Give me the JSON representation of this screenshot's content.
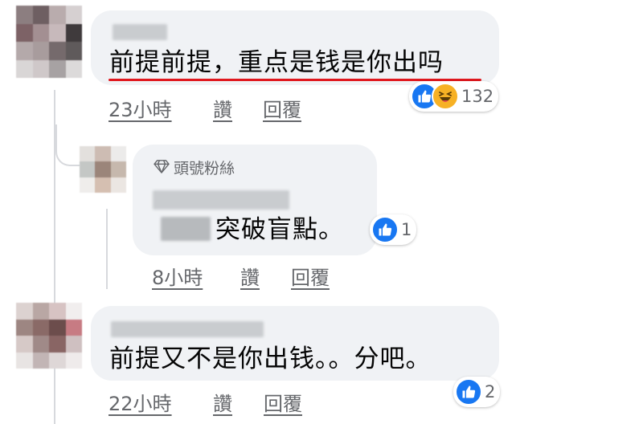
{
  "comments": [
    {
      "text": "前提前提，重点是钱是你出吗",
      "actions": {
        "time": "23小時",
        "like": "讚",
        "reply": "回覆"
      },
      "reactions": {
        "icons": [
          "like-icon",
          "haha-icon"
        ],
        "count": "132"
      }
    },
    {
      "badge": "頭號粉絲",
      "text": "突破盲點。",
      "actions": {
        "time": "8小時",
        "like": "讚",
        "reply": "回覆"
      },
      "reactions": {
        "icons": [
          "like-icon"
        ],
        "count": "1"
      }
    },
    {
      "text": "前提又不是你出钱。。分吧。",
      "actions": {
        "time": "22小時",
        "like": "讚",
        "reply": "回覆"
      },
      "reactions": {
        "icons": [
          "like-icon"
        ],
        "count": "2"
      }
    }
  ],
  "colors": {
    "bubble": "#f0f2f5",
    "like_blue": "#1877f2",
    "haha_yellow": "#f7b125",
    "annotation_red": "#e0181e",
    "meta_gray": "#65676b"
  }
}
